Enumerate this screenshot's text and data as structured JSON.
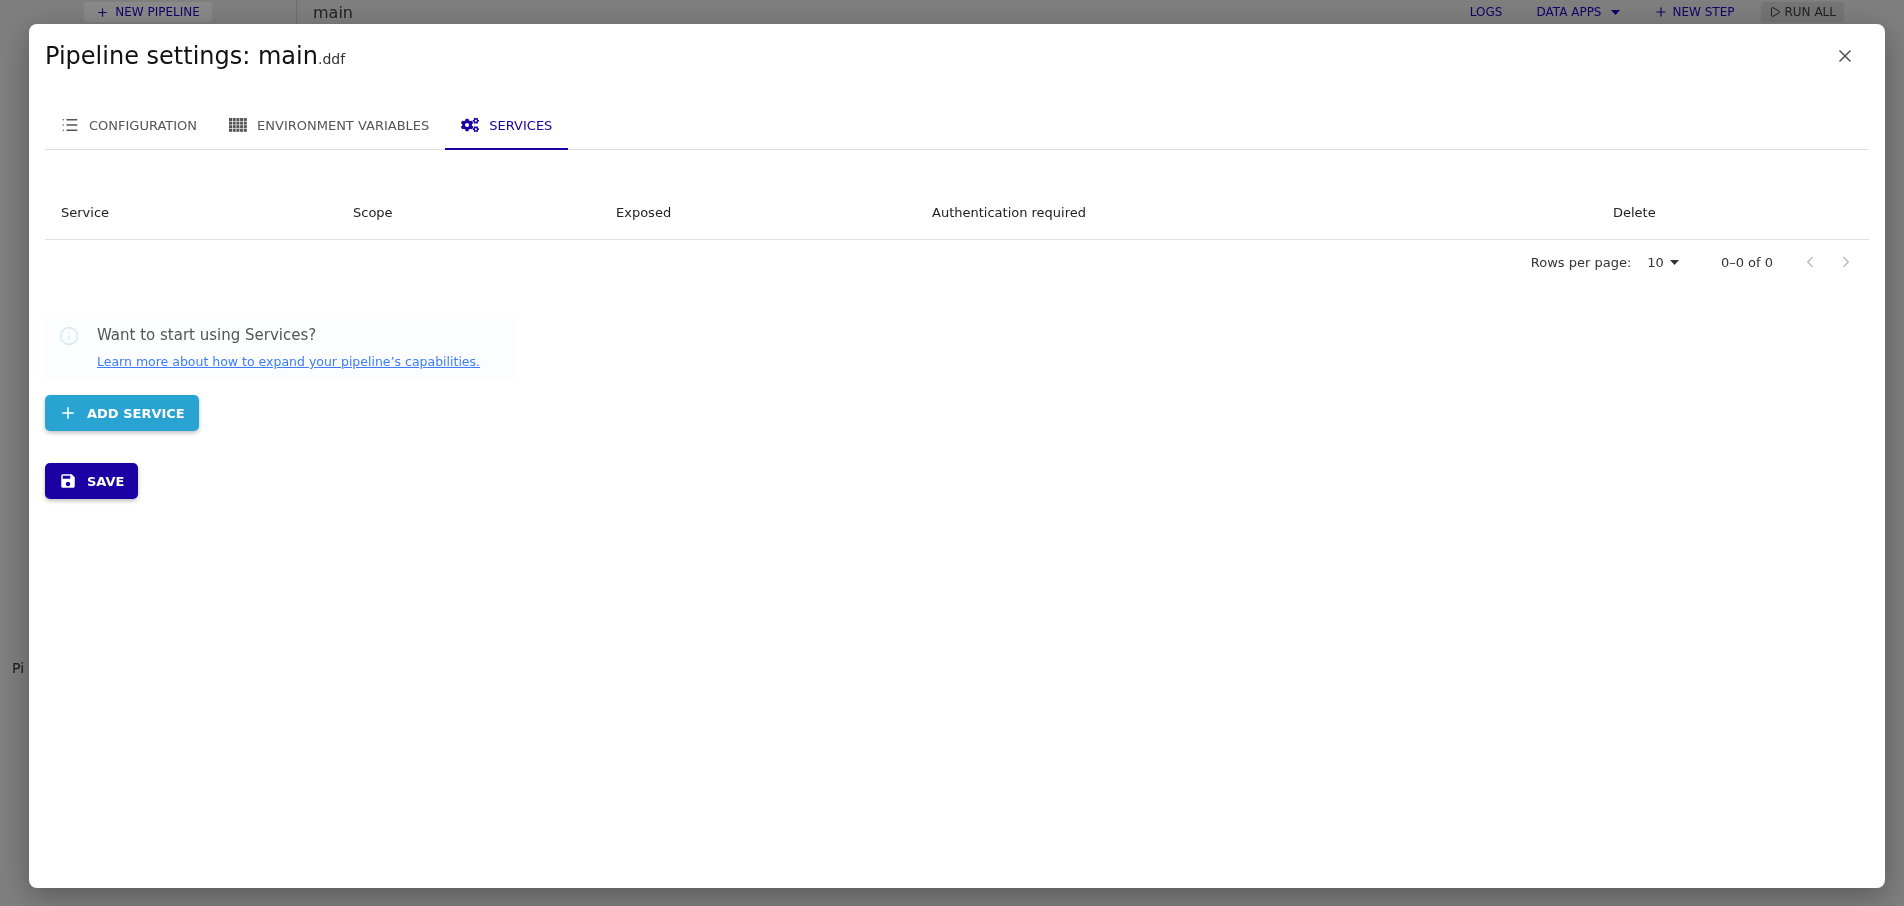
{
  "background": {
    "new_pipeline_button": "NEW PIPELINE",
    "pipeline_title": "main",
    "toolbar": [
      {
        "label": "LOGS",
        "kind": "link"
      },
      {
        "label": "DATA APPS",
        "kind": "dropdown"
      },
      {
        "label": "NEW STEP",
        "kind": "add"
      },
      {
        "label": "RUN ALL",
        "kind": "run"
      }
    ],
    "sidebar_label": "Pi"
  },
  "dialog": {
    "title": "Pipeline settings: main",
    "file_ext": ".ddf",
    "tabs": [
      {
        "label": "CONFIGURATION",
        "kind": "list",
        "selected": false
      },
      {
        "label": "ENVIRONMENT VARIABLES",
        "kind": "grid",
        "selected": false
      },
      {
        "label": "SERVICES",
        "kind": "gears",
        "selected": true
      }
    ],
    "table": {
      "columns": [
        "Service",
        "Scope",
        "Exposed",
        "Authentication required",
        "Delete"
      ]
    },
    "pagination": {
      "rows_per_page_label": "Rows per page:",
      "rows_per_page": "10",
      "range": "0–0 of 0",
      "previous_disabled": true,
      "next_disabled": true
    },
    "info": {
      "title": "Want to start using Services?",
      "link": "Learn more about how to expand your pipeline’s capabilities."
    },
    "add_button": "ADD SERVICE",
    "save_button": "SAVE"
  }
}
